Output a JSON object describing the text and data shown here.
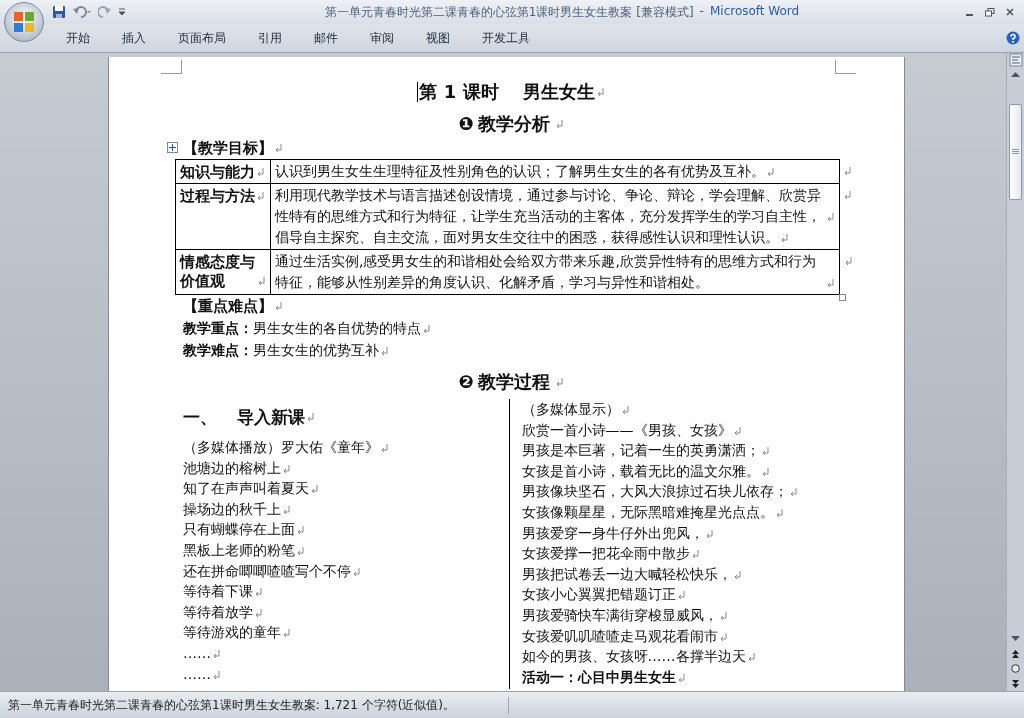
{
  "window": {
    "title": "第一单元青春时光第二课青春的心弦第1课时男生女生教案 [兼容模式]",
    "separator": "-",
    "app_name": "Microsoft Word"
  },
  "tabs": [
    {
      "label": "开始"
    },
    {
      "label": "插入"
    },
    {
      "label": "页面布局"
    },
    {
      "label": "引用"
    },
    {
      "label": "邮件"
    },
    {
      "label": "审阅"
    },
    {
      "label": "视图"
    },
    {
      "label": "开发工具"
    }
  ],
  "document": {
    "title": {
      "lesson": "第 1 课时",
      "topic": "男生女生"
    },
    "analysis_heading": {
      "number": "❶",
      "text": "教学分析"
    },
    "goals_label": "【教学目标】",
    "goals_table": [
      {
        "label": "知识与能力",
        "paragraphs": [
          "认识到男生女生生理特征及性别角色的认识；了解男生女生的各有优势及互补。"
        ]
      },
      {
        "label": "过程与方法",
        "paragraphs": [
          "利用现代教学技术与语言描述创设情境，通过参与讨论、争论、辩论，学会理解、欣赏异性特有的思维方式和行为特征，让学生充当活动的主客体，充分发挥学生的学习自主性，",
          "倡导自主探究、自主交流，面对男女生交往中的困惑，获得感性认识和理性认识。"
        ]
      },
      {
        "label": "情感态度与价值观",
        "paragraphs": [
          "通过生活实例,感受男女生的和谐相处会给双方带来乐趣,欣赏异性特有的思维方式和行为特征，能够从性别差异的角度认识、化解矛盾，学习与异性和谐相处。"
        ]
      }
    ],
    "key_points_label": "【重点难点】",
    "key_points": [
      "**教学重点：**男生女生的各自优势的特点",
      "**教学难点：**男生女生的优势互补"
    ],
    "process_heading": {
      "number": "❷",
      "text": "教学过程"
    },
    "left_column": {
      "heading": {
        "number": "一、",
        "text": "导入新课"
      },
      "lines": [
        "（多媒体播放）罗大佑《童年》",
        "池塘边的榕树上",
        "知了在声声叫着夏天",
        "操场边的秋千上",
        "只有蝴蝶停在上面",
        "黑板上老师的粉笔",
        "还在拼命唧唧喳喳写个不停",
        "等待着下课",
        "等待着放学",
        "等待游戏的童年",
        "……",
        "……"
      ]
    },
    "right_column": {
      "lines": [
        "（多媒体显示）",
        "欣赏一首小诗——《男孩、女孩》",
        "男孩是本巨著，记着一生的英勇潇洒；",
        "女孩是首小诗，载着无比的温文尔雅。",
        "男孩像块坚石，大风大浪掠过石块儿依存；",
        "女孩像颗星星，无际黑暗难掩星光点点。",
        "男孩爱穿一身牛仔外出兜风，",
        "女孩爱撑一把花伞雨中散步",
        "男孩把试卷丢一边大喊轻松快乐，",
        "女孩小心翼翼把错题订正",
        "男孩爱骑快车满街穿梭显威风，",
        "女孩爱叽叽喳喳走马观花看闹市",
        "如今的男孩、女孩呀……各撑半边天"
      ],
      "activity_heading": "活动一：心目中男生女生"
    }
  },
  "status_bar": {
    "text": "第一单元青春时光第二课青春的心弦第1课时男生女生教案: 1,721 个字符(近似值)。"
  }
}
